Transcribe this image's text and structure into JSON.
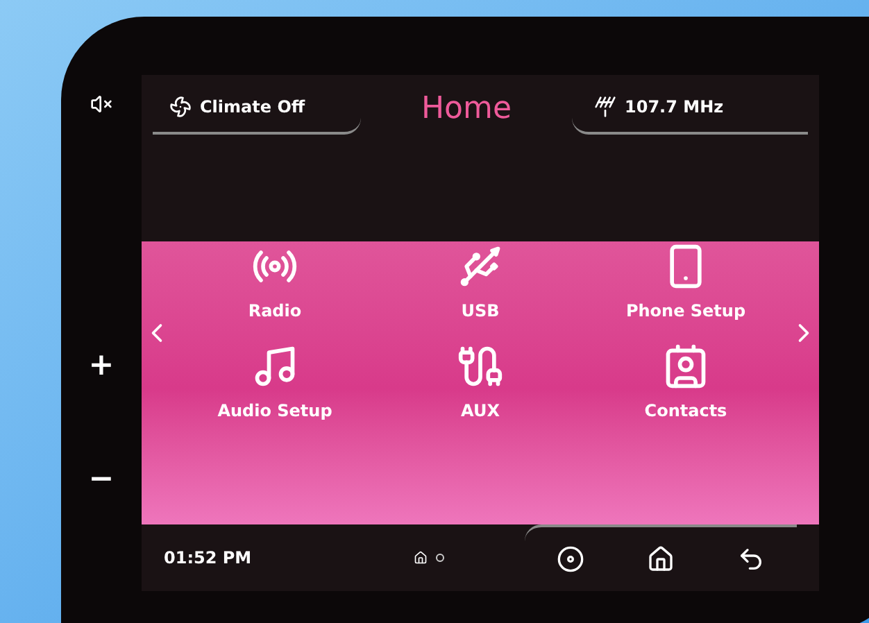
{
  "header": {
    "climate": "Climate Off",
    "title": "Home",
    "radio": "107.7 MHz"
  },
  "apps": [
    {
      "label": "Radio",
      "kind": "radio"
    },
    {
      "label": "USB",
      "kind": "usb"
    },
    {
      "label": "Phone Setup",
      "kind": "phone"
    },
    {
      "label": "Audio Setup",
      "kind": "audio"
    },
    {
      "label": "AUX",
      "kind": "aux"
    },
    {
      "label": "Contacts",
      "kind": "contacts"
    }
  ],
  "pages": [
    {
      "kind": "home",
      "selected": true
    },
    {
      "kind": "dot",
      "selected": false
    }
  ],
  "bezel": {
    "plus": "+",
    "minus": "−"
  },
  "footer": {
    "time": "01:52 PM"
  }
}
